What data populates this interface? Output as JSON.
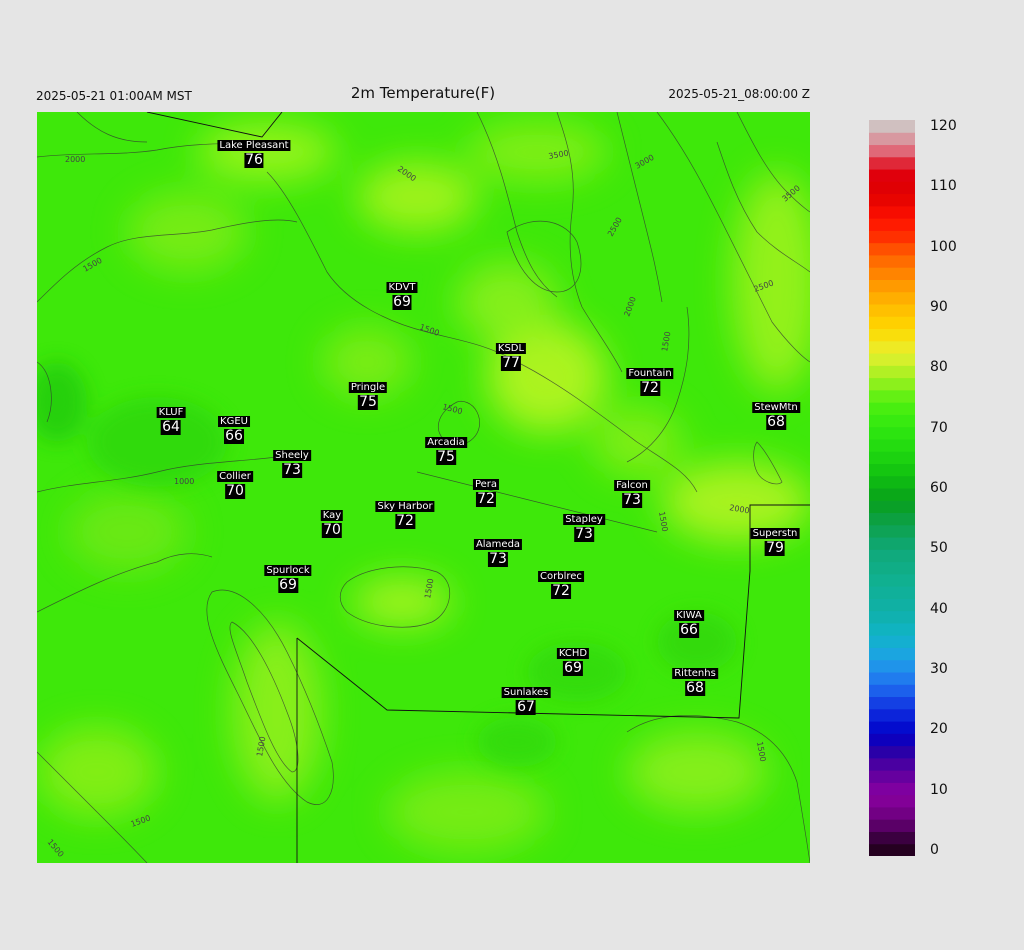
{
  "header": {
    "left": "2025-05-21 01:00AM MST",
    "title": "2m Temperature(F)",
    "right": "2025-05-21_08:00:00 Z"
  },
  "colorbar": {
    "labels": [
      "120",
      "110",
      "100",
      "90",
      "80",
      "70",
      "60",
      "50",
      "40",
      "30",
      "20",
      "10",
      "0"
    ],
    "range": [
      0,
      120
    ]
  },
  "contour_labels": [
    "2000",
    "2000",
    "3500",
    "3000",
    "3500",
    "2500",
    "2500",
    "2000",
    "1500",
    "1500",
    "1500",
    "1000",
    "1500",
    "1500",
    "2000",
    "1500",
    "1500",
    "1500",
    "1500",
    "1500"
  ],
  "stations": [
    {
      "name": "Lake Pleasant",
      "value": "76"
    },
    {
      "name": "KDVT",
      "value": "69"
    },
    {
      "name": "KSDL",
      "value": "77"
    },
    {
      "name": "Fountain",
      "value": "72"
    },
    {
      "name": "Pringle",
      "value": "75"
    },
    {
      "name": "StewMtn",
      "value": "68"
    },
    {
      "name": "KLUF",
      "value": "64"
    },
    {
      "name": "KGEU",
      "value": "66"
    },
    {
      "name": "Arcadia",
      "value": "75"
    },
    {
      "name": "Sheely",
      "value": "73"
    },
    {
      "name": "Collier",
      "value": "70"
    },
    {
      "name": "Pera",
      "value": "72"
    },
    {
      "name": "Falcon",
      "value": "73"
    },
    {
      "name": "Sky Harbor",
      "value": "72"
    },
    {
      "name": "Kay",
      "value": "70"
    },
    {
      "name": "Stapley",
      "value": "73"
    },
    {
      "name": "Superstn",
      "value": "79"
    },
    {
      "name": "Alameda",
      "value": "73"
    },
    {
      "name": "Spurlock",
      "value": "69"
    },
    {
      "name": "Corblrec",
      "value": "72"
    },
    {
      "name": "KIWA",
      "value": "66"
    },
    {
      "name": "KCHD",
      "value": "69"
    },
    {
      "name": "Rittenhs",
      "value": "68"
    },
    {
      "name": "Sunlakes",
      "value": "67"
    }
  ]
}
